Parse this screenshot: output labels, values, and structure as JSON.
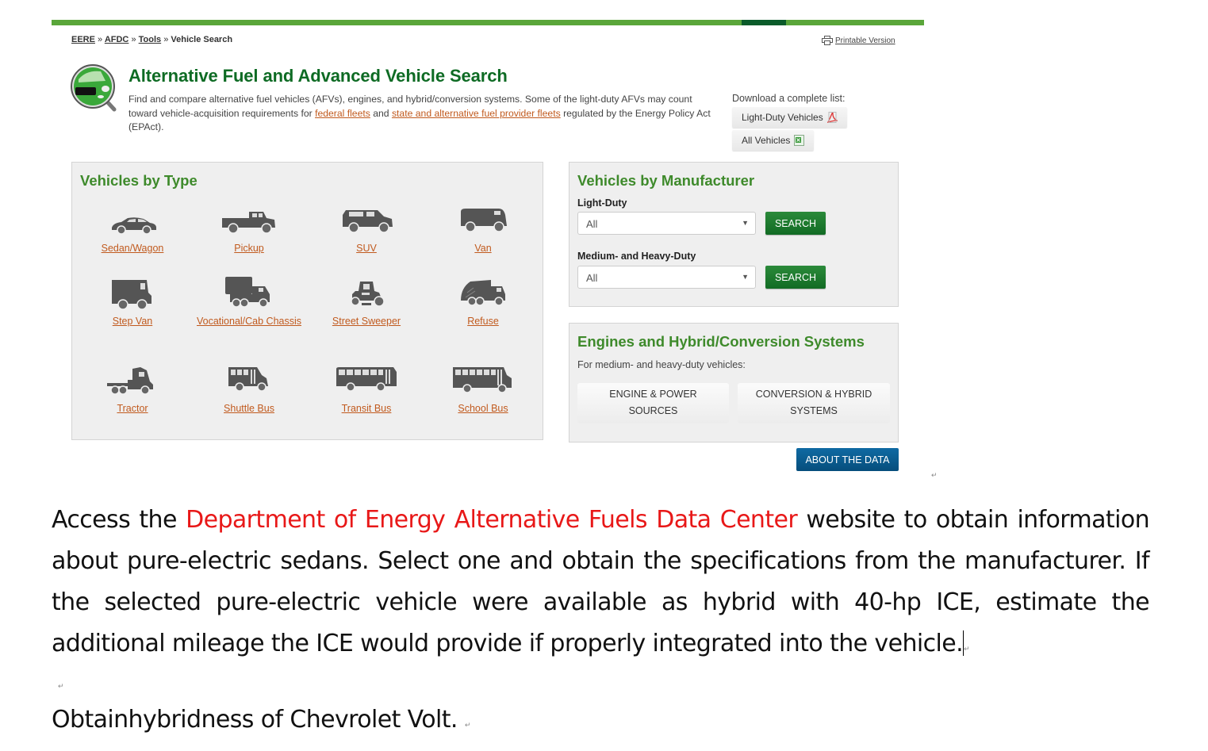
{
  "web": {
    "breadcrumb": [
      {
        "label": "EERE",
        "link": true
      },
      {
        "label": "AFDC",
        "link": true
      },
      {
        "label": "Tools",
        "link": true
      },
      {
        "label": "Vehicle Search",
        "link": false
      }
    ],
    "breadcrumb_separator": "»",
    "printable_label": "Printable Version",
    "title": "Alternative Fuel and Advanced Vehicle Search",
    "intro": {
      "text_1": "Find and compare alternative fuel vehicles (AFVs), engines, and hybrid/conversion systems. Some of the light-duty AFVs may count toward vehicle-acquisition requirements for ",
      "link_1": "federal fleets",
      "text_2": " and ",
      "link_2": "state and alternative fuel provider fleets",
      "text_3": " regulated by the Energy Policy Act (EPAct)."
    },
    "download": {
      "label": "Download a complete list:",
      "light_duty": "Light-Duty Vehicles",
      "all": "All Vehicles"
    },
    "by_type": {
      "heading": "Vehicles by Type",
      "items": [
        {
          "label": "Sedan/Wagon",
          "icon": "sedan-icon"
        },
        {
          "label": "Pickup",
          "icon": "pickup-icon"
        },
        {
          "label": "SUV",
          "icon": "suv-icon"
        },
        {
          "label": "Van",
          "icon": "van-icon"
        },
        {
          "label": "Step Van",
          "icon": "step-van-icon"
        },
        {
          "label": "Vocational/Cab Chassis",
          "icon": "cab-chassis-icon"
        },
        {
          "label": "Street Sweeper",
          "icon": "street-sweeper-icon"
        },
        {
          "label": "Refuse",
          "icon": "refuse-truck-icon"
        },
        {
          "label": "Tractor",
          "icon": "tractor-icon"
        },
        {
          "label": "Shuttle Bus",
          "icon": "shuttle-bus-icon"
        },
        {
          "label": "Transit Bus",
          "icon": "transit-bus-icon"
        },
        {
          "label": "School Bus",
          "icon": "school-bus-icon"
        }
      ]
    },
    "by_manufacturer": {
      "heading": "Vehicles by Manufacturer",
      "light_duty_label": "Light-Duty",
      "light_duty_value": "All",
      "heavy_label": "Medium- and Heavy-Duty",
      "heavy_value": "All",
      "search_label": "SEARCH"
    },
    "engines": {
      "heading": "Engines and Hybrid/Conversion Systems",
      "subtitle": "For medium- and heavy-duty vehicles:",
      "btn_engine_line1": "ENGINE & POWER",
      "btn_engine_line2": "SOURCES",
      "btn_conv_line1": "CONVERSION & HYBRID",
      "btn_conv_line2": "SYSTEMS"
    },
    "about_label": "ABOUT THE DATA",
    "colors": {
      "brand_green": "#0e6b24",
      "heading_green": "#3e8a2b",
      "link_orange": "#c15a1e",
      "about_blue": "#0a5a8e"
    }
  },
  "document": {
    "para1_pre": "Access the ",
    "para1_red": "Department of Energy Alternative Fuels Data Center",
    "para1_post": " website to obtain information about pure-electric sedans. Select one and obtain the specifications from the manufacturer. If the selected pure-electric vehicle were available as hybrid with 40-hp ICE, estimate the additional mileage the ICE would provide if properly integrated into the vehicle.",
    "para2": "Obtainhybridness of Chevrolet Volt.",
    "paragraph_mark": "↵",
    "highlight_color": "#e81818"
  }
}
